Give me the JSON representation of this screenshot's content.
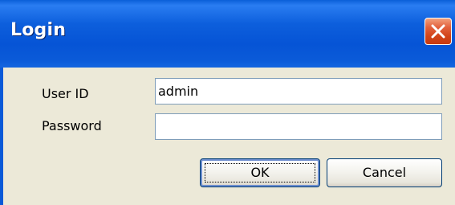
{
  "window": {
    "title": "Login"
  },
  "form": {
    "user_id_label": "User ID",
    "user_id_value": "admin",
    "password_label": "Password",
    "password_value": ""
  },
  "buttons": {
    "ok_label": "OK",
    "cancel_label": "Cancel"
  },
  "icons": {
    "close": "close-icon"
  },
  "colors": {
    "titlebar": "#0a5ad8",
    "close_button": "#d14318",
    "dialog_background": "#ece9d8",
    "field_border": "#7f9db9"
  }
}
